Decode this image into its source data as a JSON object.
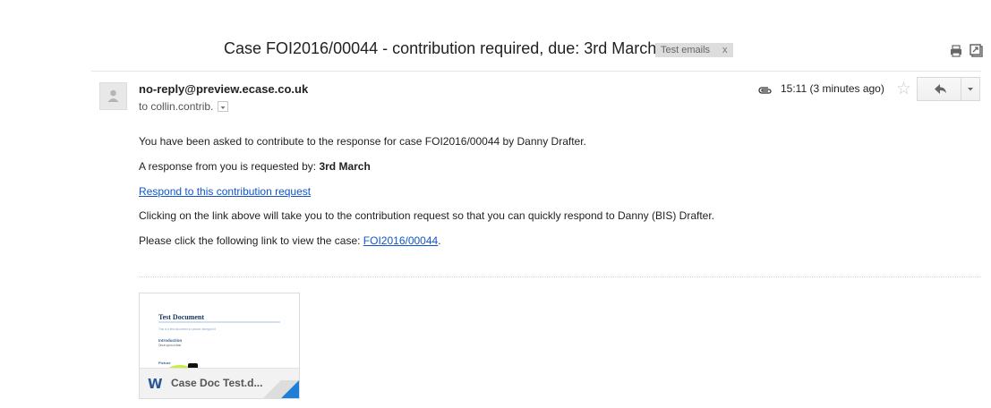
{
  "email": {
    "subject": "Case FOI2016/00044 - contribution required, due: 3rd March",
    "label": {
      "text": "Test emails",
      "remove": "x"
    },
    "sender": "no-reply@preview.ecase.co.uk",
    "recipient": "to collin.contrib.",
    "time": "15:11 (3 minutes ago)",
    "star_glyph": "☆"
  },
  "body": {
    "line1": "You have been asked to contribute to the response for case FOI2016/00044 by Danny        Drafter.",
    "line2_prefix": "A response from you is requested by: ",
    "line2_due": "3rd March",
    "link_respond": "Respond to this contribution request",
    "line4": "Clicking on the link above will take you to the contribution request so that you can quickly respond to Danny (BIS) Drafter.",
    "line5_prefix": "Please click the following link to view the case: ",
    "case_link": "FOI2016/00044",
    "line5_suffix": "."
  },
  "attachment": {
    "preview": {
      "title": "Test Document",
      "subtitle": "This is a test document so please disregard it",
      "heading": "Introduction",
      "heading_sub": "Once upon a time",
      "picture_label": "Picture"
    },
    "type_glyph": "W",
    "name": "Case Doc Test.d..."
  },
  "colors": {
    "link": "#1155cc",
    "word_blue": "#2b5797",
    "fold_blue": "#1e7fd6"
  }
}
